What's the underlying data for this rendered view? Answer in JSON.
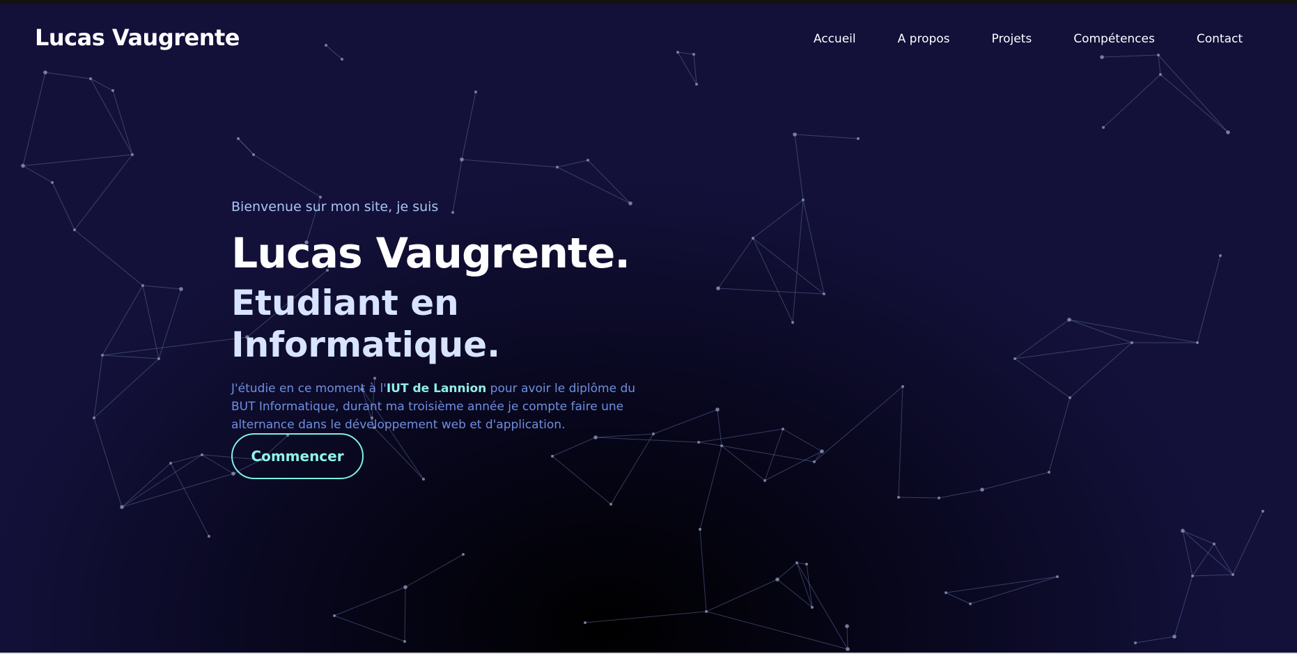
{
  "header": {
    "brand": "Lucas Vaugrente",
    "nav": [
      {
        "label": "Accueil"
      },
      {
        "label": "A propos"
      },
      {
        "label": "Projets"
      },
      {
        "label": "Compétences"
      },
      {
        "label": "Contact"
      }
    ]
  },
  "hero": {
    "intro": "Bienvenue sur mon site, je suis",
    "name": "Lucas Vaugrente.",
    "role": "Etudiant en Informatique.",
    "desc_before": "J'étudie en ce moment à l'",
    "desc_highlight": "IUT de Lannion",
    "desc_after": " pour avoir le diplôme du BUT Informatique, durant ma troisième année je compte faire une alternance dans le développement web et d'application.",
    "cta": "Commencer"
  },
  "colors": {
    "background": "#0b0a1a",
    "accent": "#7ff0e2",
    "text_muted": "#6f8fe0",
    "network_line": "#5d6a9a"
  }
}
